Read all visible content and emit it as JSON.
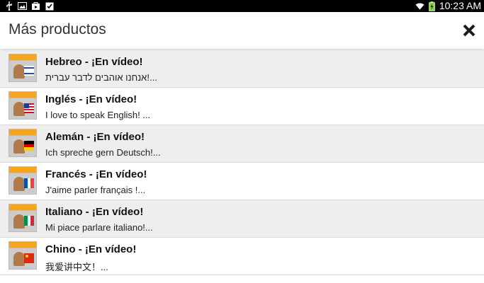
{
  "status": {
    "time": "10:23 AM",
    "left_icons": [
      "usb-icon",
      "image-icon",
      "store-icon",
      "clipboard-check-icon"
    ],
    "right_icons": [
      "wifi-icon",
      "battery-charging-icon"
    ]
  },
  "header": {
    "title": "Más productos",
    "close_icon": "close-icon"
  },
  "colors": {
    "statusbar": "#000000",
    "row_shaded": "#eeeeee",
    "row_plain": "#ffffff",
    "thumb_accent": "#f7a51c"
  },
  "products": [
    {
      "title": "Hebreo - ¡En vídeo!",
      "subtitle": "אנחנו אוהבים לדבר עברית!...",
      "flag": "israel"
    },
    {
      "title": "Inglés - ¡En vídeo!",
      "subtitle": "I love to speak English! ...",
      "flag": "usa"
    },
    {
      "title": "Alemán - ¡En vídeo!",
      "subtitle": "Ich spreche gern Deutsch!...",
      "flag": "germany"
    },
    {
      "title": "Francés - ¡En vídeo!",
      "subtitle": "J'aime parler français !...",
      "flag": "france"
    },
    {
      "title": "Italiano - ¡En vídeo!",
      "subtitle": "Mi piace parlare italiano!...",
      "flag": "italy"
    },
    {
      "title": "Chino - ¡En vídeo!",
      "subtitle": "我爱讲中文！...",
      "flag": "china"
    }
  ]
}
